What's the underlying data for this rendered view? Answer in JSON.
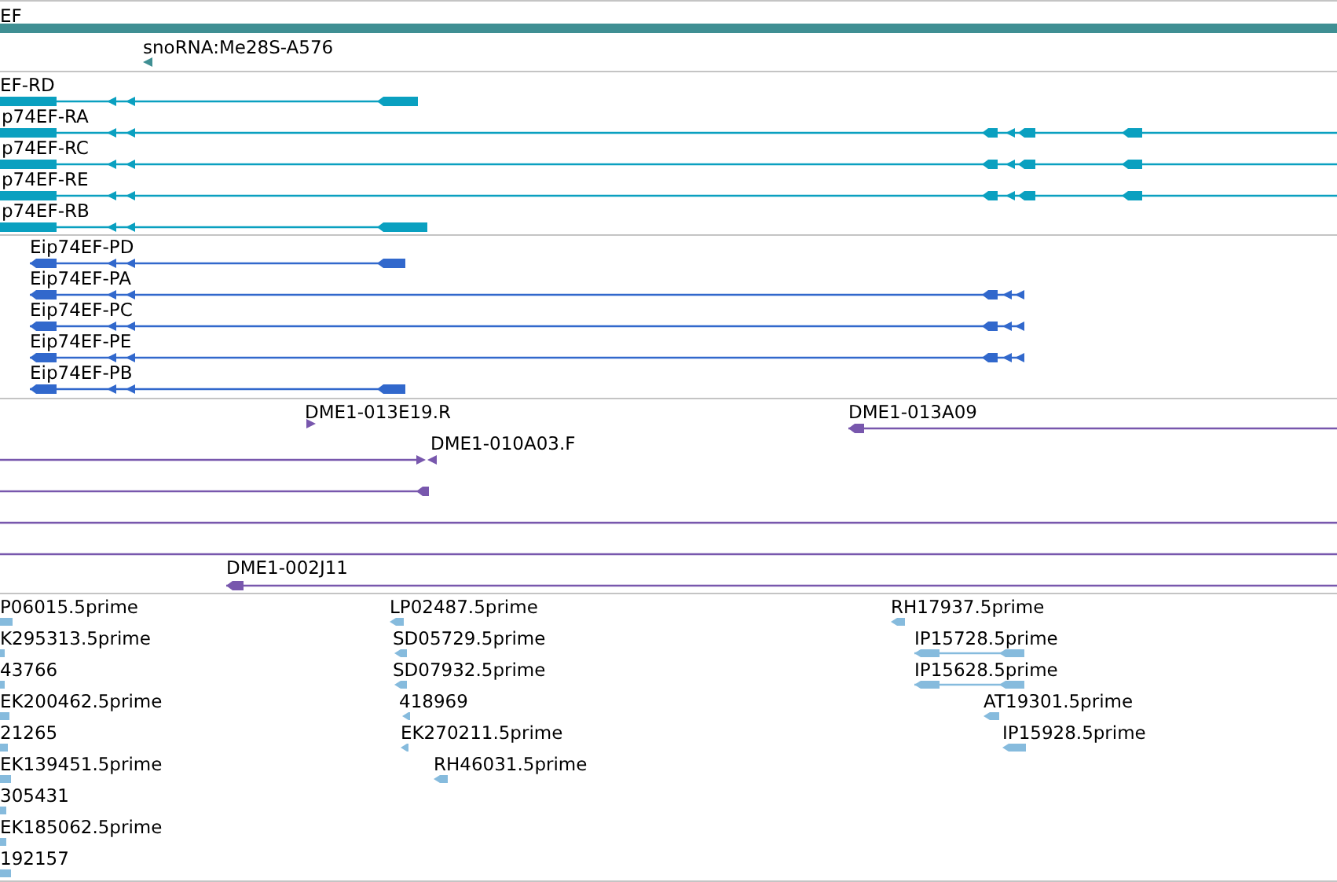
{
  "tracks": [
    {
      "kind": "gene",
      "features": [
        {
          "label": "EF"
        },
        {
          "label": "snoRNA:Me28S-A576"
        }
      ]
    },
    {
      "kind": "transcript",
      "features": [
        {
          "label": "EF-RD"
        },
        {
          "label": "p74EF-RA"
        },
        {
          "label": "p74EF-RC"
        },
        {
          "label": "p74EF-RE"
        },
        {
          "label": "p74EF-RB"
        }
      ]
    },
    {
      "kind": "protein",
      "features": [
        {
          "label": "Eip74EF-PD"
        },
        {
          "label": "Eip74EF-PA"
        },
        {
          "label": "Eip74EF-PC"
        },
        {
          "label": "Eip74EF-PE"
        },
        {
          "label": "Eip74EF-PB"
        }
      ]
    },
    {
      "kind": "clone",
      "features": [
        {
          "label": "DME1-013E19.R"
        },
        {
          "label": "DME1-013A09"
        },
        {
          "label": "DME1-010A03.F"
        },
        {
          "label": "DME1-002J11"
        }
      ]
    },
    {
      "kind": "est",
      "features": [
        {
          "label": "P06015.5prime"
        },
        {
          "label": "K295313.5prime"
        },
        {
          "label": "43766"
        },
        {
          "label": "EK200462.5prime"
        },
        {
          "label": "21265"
        },
        {
          "label": "EK139451.5prime"
        },
        {
          "label": "305431"
        },
        {
          "label": "EK185062.5prime"
        },
        {
          "label": "192157"
        },
        {
          "label": "LP02487.5prime"
        },
        {
          "label": "SD05729.5prime"
        },
        {
          "label": "SD07932.5prime"
        },
        {
          "label": "418969"
        },
        {
          "label": "EK270211.5prime"
        },
        {
          "label": "RH46031.5prime"
        },
        {
          "label": "RH17937.5prime"
        },
        {
          "label": "IP15728.5prime"
        },
        {
          "label": "IP15628.5prime"
        },
        {
          "label": "AT19301.5prime"
        },
        {
          "label": "IP15928.5prime"
        }
      ]
    }
  ]
}
